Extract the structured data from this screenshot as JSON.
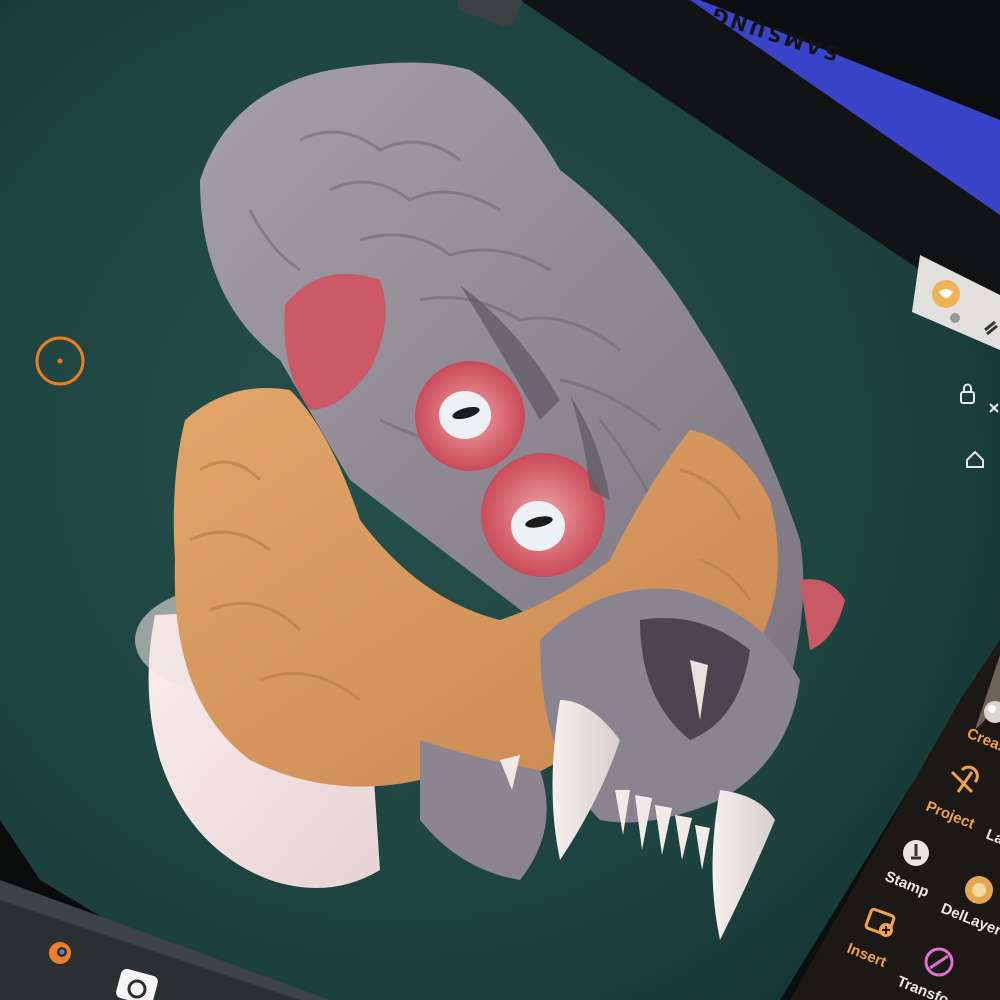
{
  "device": {
    "brand": "SAMSUNG"
  },
  "tools": {
    "crease": "Crease",
    "project": "Project",
    "layer": "La",
    "stamp": "Stamp",
    "dellayer": "DelLayer",
    "insert": "Insert",
    "transform": "Transfo"
  },
  "colors": {
    "viewport_bg": "#1f4440",
    "accent": "#f29a3a",
    "mesh_gray": "#8d8790",
    "mesh_orange": "#d79a61",
    "mesh_pink": "#c95a68"
  }
}
